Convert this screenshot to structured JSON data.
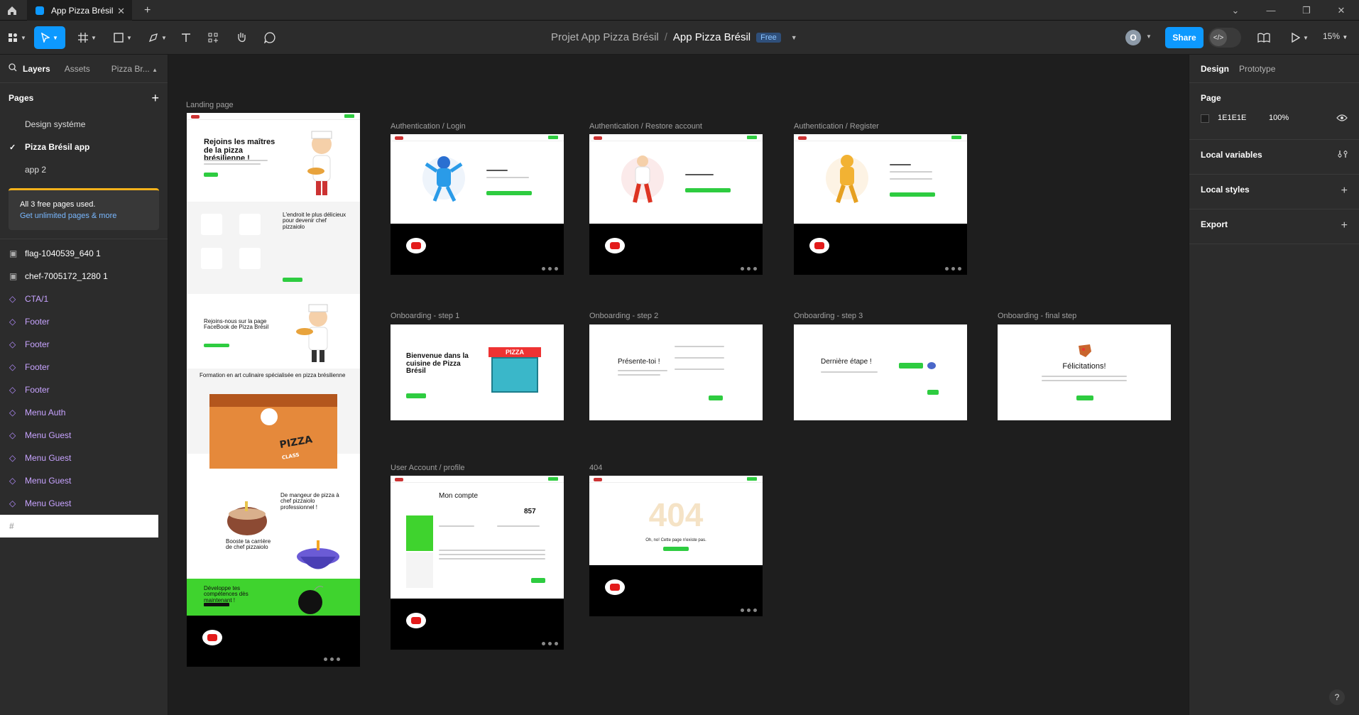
{
  "tab": {
    "title": "App Pizza Brésil"
  },
  "toolbar": {
    "project": "Projet App Pizza Brésil",
    "sep": "/",
    "file": "App Pizza Brésil",
    "plan": "Free",
    "avatar_letter": "O",
    "share_label": "Share",
    "zoom": "15%"
  },
  "left": {
    "tabs": {
      "layers": "Layers",
      "assets": "Assets",
      "page": "Pizza Br..."
    },
    "pages_title": "Pages",
    "pages": [
      "Design systéme",
      "Pizza Brésil app",
      "app 2"
    ],
    "upsell": {
      "text": "All 3 free pages used.",
      "link": "Get unlimited pages & more"
    },
    "layers": [
      {
        "name": "flag-1040539_640 1",
        "kind": "image"
      },
      {
        "name": "chef-7005172_1280 1",
        "kind": "image"
      },
      {
        "name": "CTA/1",
        "kind": "component"
      },
      {
        "name": "Footer",
        "kind": "component"
      },
      {
        "name": "Footer",
        "kind": "component"
      },
      {
        "name": "Footer",
        "kind": "component"
      },
      {
        "name": "Footer",
        "kind": "component"
      },
      {
        "name": "Menu Auth",
        "kind": "component"
      },
      {
        "name": "Menu Guest",
        "kind": "component"
      },
      {
        "name": "Menu Guest",
        "kind": "component"
      },
      {
        "name": "Menu Guest",
        "kind": "component"
      },
      {
        "name": "Menu Guest",
        "kind": "component"
      },
      {
        "name": "404",
        "kind": "frame"
      },
      {
        "name": "User Account / profile",
        "kind": "frame"
      },
      {
        "name": "Onboarding - final step",
        "kind": "frame"
      },
      {
        "name": "Onboarding - step 3",
        "kind": "frame"
      },
      {
        "name": "Onboarding - step 2",
        "kind": "frame"
      },
      {
        "name": "Onboarding - step 1",
        "kind": "frame"
      },
      {
        "name": "Authentication / Register",
        "kind": "frame"
      },
      {
        "name": "Authentication / Restore account",
        "kind": "frame"
      },
      {
        "name": "Authentication / Login",
        "kind": "frame"
      }
    ]
  },
  "right": {
    "tabs": {
      "design": "Design",
      "prototype": "Prototype"
    },
    "page_section": "Page",
    "page_color": "1E1E1E",
    "page_opacity": "100%",
    "local_variables": "Local variables",
    "local_styles": "Local styles",
    "export": "Export"
  },
  "canvas": {
    "frames": {
      "landing": "Landing page",
      "login": "Authentication / Login",
      "restore": "Authentication / Restore account",
      "register": "Authentication / Register",
      "onb1": "Onboarding - step 1",
      "onb2": "Onboarding - step 2",
      "onb3": "Onboarding - step 3",
      "onbf": "Onboarding - final step",
      "account": "User Account / profile",
      "notfound": "404"
    },
    "landing": {
      "hero": "Rejoins les maîtres de la pizza brésilienne !",
      "place": "L'endroit le plus délicieux pour devenir chef pizzaiolo",
      "fb": "Rejoins-nous sur la page FaceBook de Pizza Brésil",
      "formation": "Formation en art culinaire spécialisée en pizza brésilienne",
      "pizza_class": "PIZZA",
      "pizza_class2": "CLASS",
      "pro": "De mangeur de pizza à chef pizzaiolo professionnel !",
      "boost": "Booste ta carrière de chef pizzaiolo",
      "cta": "Développe tes compétences dès maintenant !"
    },
    "onb1": {
      "title": "Bienvenue dans la cuisine de Pizza Brésil",
      "sign": "PIZZA"
    },
    "onb2": {
      "title": "Présente-toi !"
    },
    "onb3": {
      "title": "Dernière étape !"
    },
    "onbf": {
      "title": "Félicitations!"
    },
    "account": {
      "title": "Mon compte",
      "points": "857"
    },
    "notfound": {
      "code": "404",
      "msg": "Oh, no! Cette page n'existe pas."
    }
  }
}
